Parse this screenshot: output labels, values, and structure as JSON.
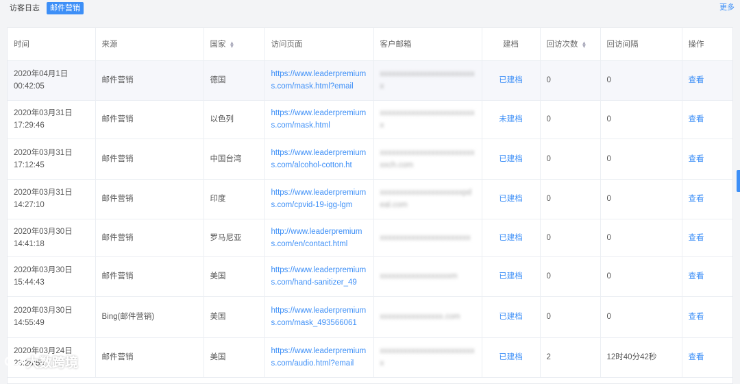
{
  "tabs": [
    "访客日志",
    "邮件营销"
  ],
  "more_label": "更多",
  "columns": {
    "time": "时间",
    "source": "来源",
    "country": "国家",
    "page": "访问页面",
    "email": "客户邮箱",
    "archive": "建档",
    "visits": "回访次数",
    "interval": "回访间隔",
    "action": "操作"
  },
  "rows": [
    {
      "time": "2020年04月1日 00:42:05",
      "source": "邮件营销",
      "country": "德国",
      "page": "https://www.leaderpremiums.com/mask.html?email",
      "email": "xxxxxxxxxxxxxxxxxxxxxxxxx",
      "archive": "已建档",
      "visits": "0",
      "interval": "0",
      "action": "查看"
    },
    {
      "time": "2020年03月31日 17:29:46",
      "source": "邮件营销",
      "country": "以色列",
      "page": "https://www.leaderpremiums.com/mask.html",
      "email": "xxxxxxxxxxxxxxxxxxxxxxxxx",
      "archive": "未建档",
      "visits": "0",
      "interval": "0",
      "action": "查看"
    },
    {
      "time": "2020年03月31日 17:12:45",
      "source": "邮件营销",
      "country": "中国台湾",
      "page": "https://www.leaderpremiums.com/alcohol-cotton.ht",
      "email": "xxxxxxxxxxxxxxxxxxxxxxxxxxch.com",
      "archive": "已建档",
      "visits": "0",
      "interval": "0",
      "action": "查看"
    },
    {
      "time": "2020年03月31日 14:27:10",
      "source": "邮件营销",
      "country": "印度",
      "page": "https://www.leaderpremiums.com/cpvid-19-igg-lgm",
      "email": "xxxxxxxxxxxxxxxxxxxxxpdeal.com",
      "archive": "已建档",
      "visits": "0",
      "interval": "0",
      "action": "查看"
    },
    {
      "time": "2020年03月30日 14:41:18",
      "source": "邮件营销",
      "country": "罗马尼亚",
      "page": "http://www.leaderpremiums.com/en/contact.html",
      "email": "xxxxxxxxxxxxxxxxxxxxxxx",
      "archive": "已建档",
      "visits": "0",
      "interval": "0",
      "action": "查看"
    },
    {
      "time": "2020年03月30日 15:44:43",
      "source": "邮件营销",
      "country": "美国",
      "page": "https://www.leaderpremiums.com/hand-sanitizer_49",
      "email": "xxxxxxxxxxxxxxxxxxm",
      "archive": "已建档",
      "visits": "0",
      "interval": "0",
      "action": "查看"
    },
    {
      "time": "2020年03月30日 14:55:49",
      "source": "Bing(邮件营销)",
      "country": "美国",
      "page": "https://www.leaderpremiums.com/mask_493566061",
      "email": "xxxxxxxxxxxxxxxx.com",
      "archive": "已建档",
      "visits": "0",
      "interval": "0",
      "action": "查看"
    },
    {
      "time": "2020年03月24日 23:28:55",
      "source": "邮件营销",
      "country": "美国",
      "page": "https://www.leaderpremiums.com/audio.html?email",
      "email": "xxxxxxxxxxxxxxxxxxxxxxxxx",
      "archive": "已建档",
      "visits": "2",
      "interval": "12时40分42秒",
      "action": "查看"
    }
  ],
  "watermark": "大数跨境",
  "colors": {
    "accent": "#3d8ff7",
    "row_highlight": "#f6f7fb"
  }
}
